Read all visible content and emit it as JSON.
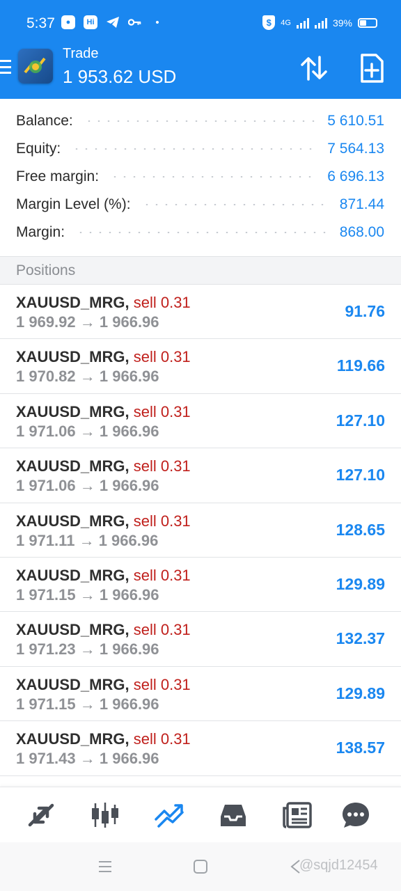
{
  "status_bar": {
    "time": "5:37",
    "network": "4G",
    "battery": "39%",
    "battery_level": 0.39
  },
  "app_bar": {
    "title": "Trade",
    "balance": "1 953.62 USD"
  },
  "summary": [
    {
      "label": "Balance:",
      "value": "5 610.51"
    },
    {
      "label": "Equity:",
      "value": "7 564.13"
    },
    {
      "label": "Free margin:",
      "value": "6 696.13"
    },
    {
      "label": "Margin Level (%):",
      "value": "871.44"
    },
    {
      "label": "Margin:",
      "value": "868.00"
    }
  ],
  "positions_header": "Positions",
  "positions": [
    {
      "symbol": "XAUUSD_MRG",
      "sep": ",",
      "direction": "sell 0.31",
      "open_price": "1 969.92",
      "arrow": "→",
      "current_price": "1 966.96",
      "profit": "91.76"
    },
    {
      "symbol": "XAUUSD_MRG",
      "sep": ",",
      "direction": "sell 0.31",
      "open_price": "1 970.82",
      "arrow": "→",
      "current_price": "1 966.96",
      "profit": "119.66"
    },
    {
      "symbol": "XAUUSD_MRG",
      "sep": ",",
      "direction": "sell 0.31",
      "open_price": "1 971.06",
      "arrow": "→",
      "current_price": "1 966.96",
      "profit": "127.10"
    },
    {
      "symbol": "XAUUSD_MRG",
      "sep": ",",
      "direction": "sell 0.31",
      "open_price": "1 971.06",
      "arrow": "→",
      "current_price": "1 966.96",
      "profit": "127.10"
    },
    {
      "symbol": "XAUUSD_MRG",
      "sep": ",",
      "direction": "sell 0.31",
      "open_price": "1 971.11",
      "arrow": "→",
      "current_price": "1 966.96",
      "profit": "128.65"
    },
    {
      "symbol": "XAUUSD_MRG",
      "sep": ",",
      "direction": "sell 0.31",
      "open_price": "1 971.15",
      "arrow": "→",
      "current_price": "1 966.96",
      "profit": "129.89"
    },
    {
      "symbol": "XAUUSD_MRG",
      "sep": ",",
      "direction": "sell 0.31",
      "open_price": "1 971.23",
      "arrow": "→",
      "current_price": "1 966.96",
      "profit": "132.37"
    },
    {
      "symbol": "XAUUSD_MRG",
      "sep": ",",
      "direction": "sell 0.31",
      "open_price": "1 971.15",
      "arrow": "→",
      "current_price": "1 966.96",
      "profit": "129.89"
    },
    {
      "symbol": "XAUUSD_MRG",
      "sep": ",",
      "direction": "sell 0.31",
      "open_price": "1 971.43",
      "arrow": "→",
      "current_price": "1 966.96",
      "profit": "138.57"
    }
  ],
  "bottom_nav": [
    {
      "icon": "quotes-icon"
    },
    {
      "icon": "chart-candles-icon"
    },
    {
      "icon": "trade-icon",
      "active": true
    },
    {
      "icon": "history-inbox-icon"
    },
    {
      "icon": "news-icon"
    },
    {
      "icon": "chat-icon"
    }
  ],
  "watermark": "@sqjd12454",
  "colors": {
    "primary": "#1a87f0",
    "sell": "#c0201c",
    "price_gray": "#8f9195",
    "nav_icon": "#4a4f57"
  }
}
